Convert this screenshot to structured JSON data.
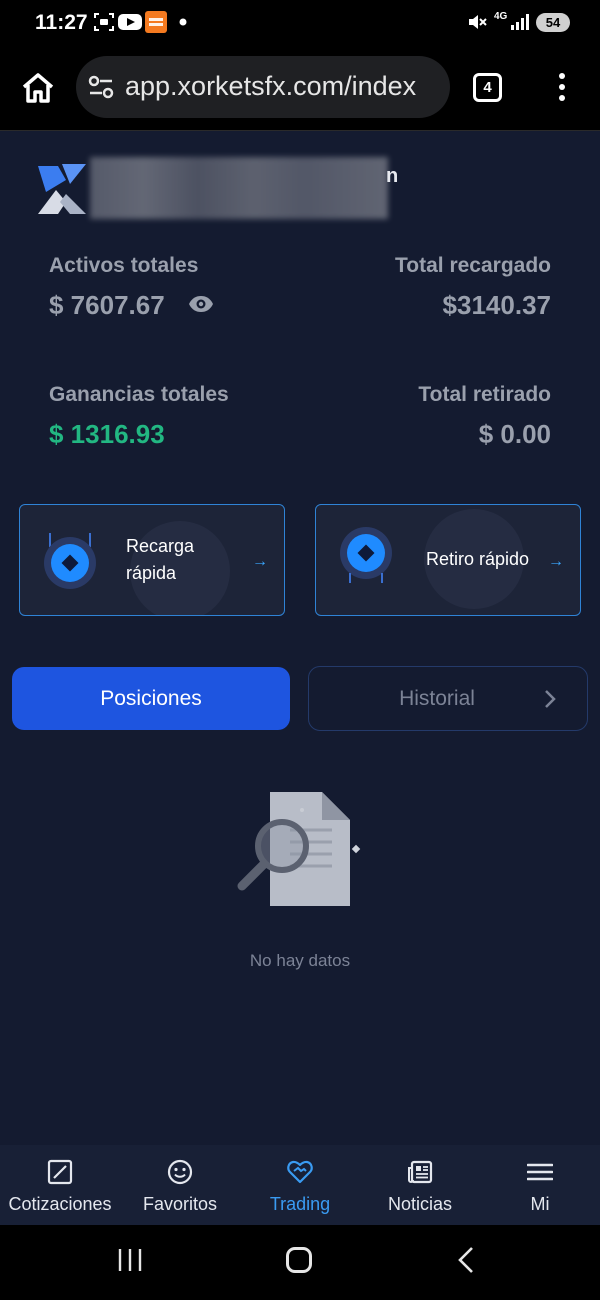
{
  "status_bar": {
    "time": "11:27",
    "network": "4G",
    "battery": "54",
    "icons": [
      "screenshot-icon",
      "youtube-icon",
      "temu-icon",
      "dot-icon",
      "mute-icon",
      "signal-icon"
    ]
  },
  "browser": {
    "url": "app.xorketsfx.com/index",
    "tab_count": "4",
    "icons": [
      "home-icon",
      "site-settings-icon",
      "tabs-icon",
      "more-vert-icon"
    ]
  },
  "account": {
    "username_suffix": "n"
  },
  "stats": {
    "total_assets_label": "Activos totales",
    "total_assets_value": "$ 7607.67",
    "total_recharged_label": "Total recargado",
    "total_recharged_value": "$3140.37",
    "total_profit_label": "Ganancias totales",
    "total_profit_value": "$ 1316.93",
    "total_withdrawn_label": "Total retirado",
    "total_withdrawn_value": "$ 0.00"
  },
  "actions": {
    "recharge_label_line1": "Recarga",
    "recharge_label_line2": "rápida",
    "withdraw_label": "Retiro rápido",
    "arrow": "→"
  },
  "tabs": {
    "positions": "Posiciones",
    "history": "Historial"
  },
  "empty": {
    "text": "No hay datos"
  },
  "bottom_nav": [
    {
      "label": "Cotizaciones",
      "icon": "chart-icon"
    },
    {
      "label": "Favoritos",
      "icon": "smiley-icon"
    },
    {
      "label": "Trading",
      "icon": "handshake-heart-icon",
      "active": true
    },
    {
      "label": "Noticias",
      "icon": "newspaper-icon"
    },
    {
      "label": "Mi",
      "icon": "menu-icon"
    }
  ],
  "colors": {
    "background": "#141b30",
    "accent_blue": "#1e55e0",
    "profit_green": "#22b782",
    "active_nav": "#3a9bf2"
  }
}
